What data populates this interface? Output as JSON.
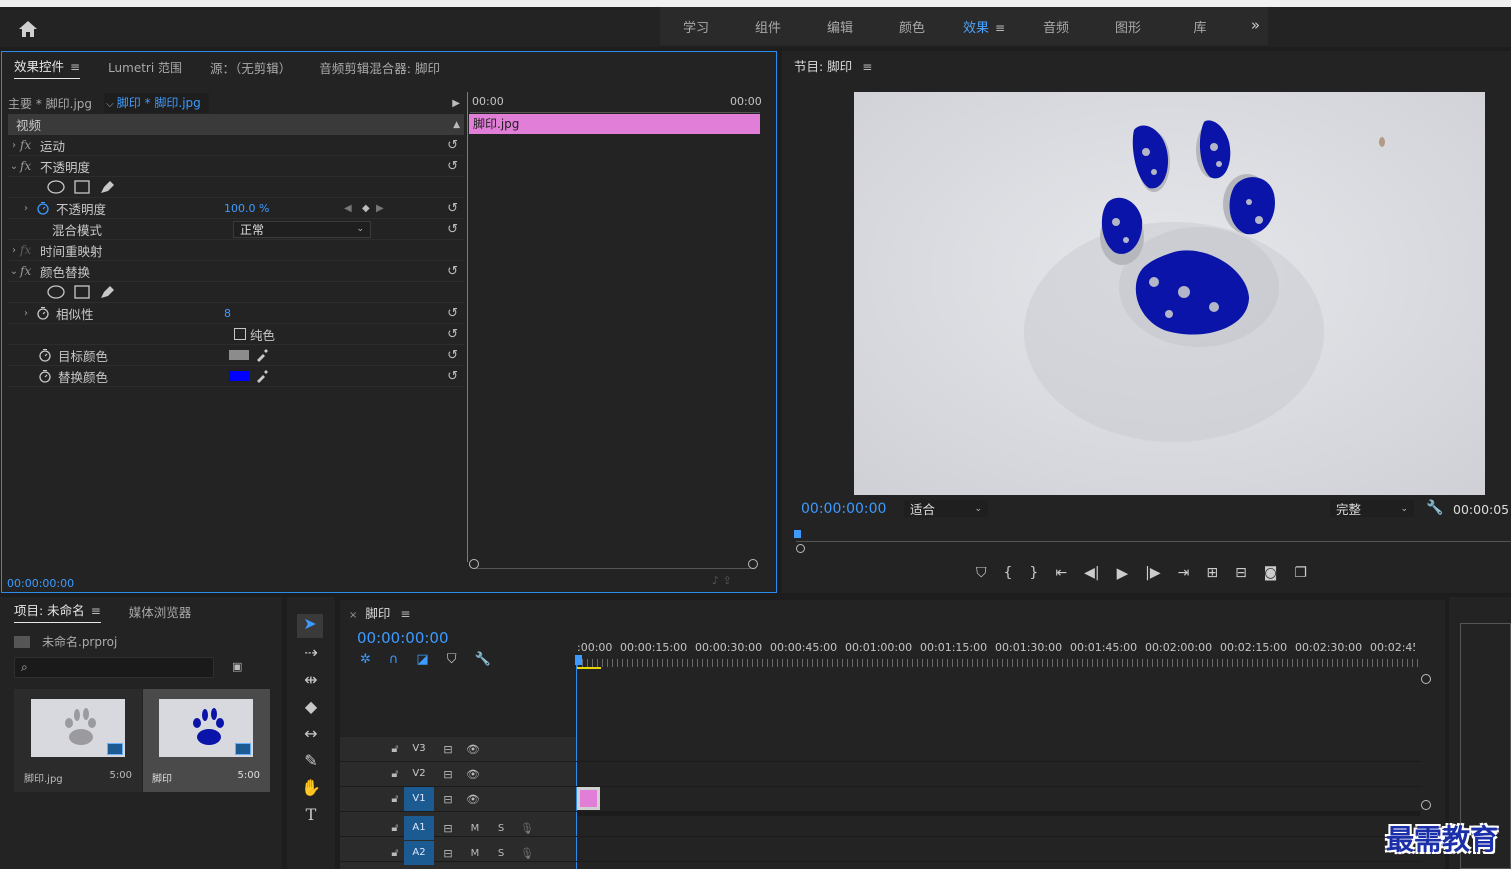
{
  "workspace": {
    "tabs": [
      "学习",
      "组件",
      "编辑",
      "颜色",
      "效果",
      "音频",
      "图形",
      "库"
    ],
    "active_index": 4
  },
  "effect_controls": {
    "tabs": [
      "效果控件",
      "Lumetri 范围",
      "源：（无剪辑）",
      "音频剪辑混合器: 脚印"
    ],
    "master_clip": "主要 * 脚印.jpg",
    "sequence_clip": "脚印 * 脚印.jpg",
    "ruler_start": "00:00",
    "ruler_end": "00:00",
    "clip_label": "脚印.jpg",
    "section": "视频",
    "motion": "运动",
    "opacity_group": "不透明度",
    "opacity_label": "不透明度",
    "opacity_value": "100.0 %",
    "blend_label": "混合模式",
    "blend_value": "正常",
    "time_remap": "时间重映射",
    "color_replace": "颜色替换",
    "similarity_label": "相似性",
    "similarity_value": "8",
    "solid_label": "纯色",
    "target_label": "目标颜色",
    "replace_label": "替换颜色",
    "target_color": "#8c8c8c",
    "replace_color": "#0000ff",
    "timecode": "00:00:00:00"
  },
  "program": {
    "title": "节目: 脚印",
    "timecode": "00:00:00:00",
    "fit": "适合",
    "quality": "完整",
    "duration": "00:00:05"
  },
  "project": {
    "tabs": [
      "项目: 未命名",
      "媒体浏览器"
    ],
    "file": "未命名.prproj",
    "items": [
      {
        "name": "脚印.jpg",
        "duration": "5:00"
      },
      {
        "name": "脚印",
        "duration": "5:00"
      }
    ]
  },
  "timeline": {
    "title": "脚印",
    "timecode": "00:00:00:00",
    "ruler": [
      ":00:00",
      "00:00:15:00",
      "00:00:30:00",
      "00:00:45:00",
      "00:01:00:00",
      "00:01:15:00",
      "00:01:30:00",
      "00:01:45:00",
      "00:02:00:00",
      "00:02:15:00",
      "00:02:30:00",
      "00:02:45:"
    ],
    "video_tracks": [
      "V3",
      "V2",
      "V1"
    ],
    "audio_tracks": [
      "A1",
      "A2"
    ],
    "mute": "M",
    "solo": "S",
    "clip_color": "#e07ed8"
  },
  "watermark": "最需教育"
}
